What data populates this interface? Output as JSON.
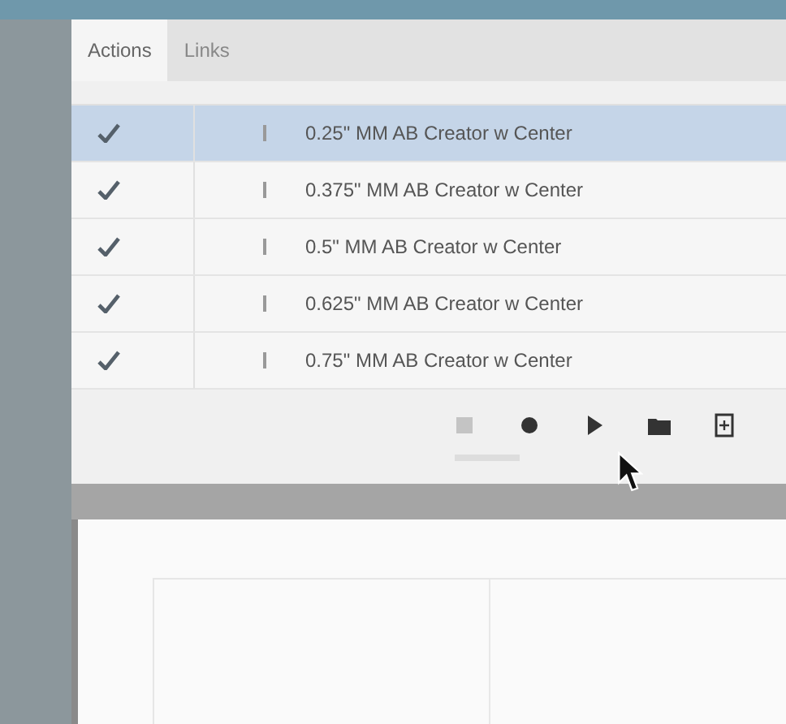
{
  "tabs": [
    {
      "label": "Actions",
      "selected": true
    },
    {
      "label": "Links",
      "selected": false
    }
  ],
  "actions": [
    {
      "name": "0.25\" MM AB Creator w Center",
      "checked": true,
      "selected": true
    },
    {
      "name": "0.375\" MM AB Creator w Center",
      "checked": true,
      "selected": false
    },
    {
      "name": "0.5\" MM AB Creator w Center",
      "checked": true,
      "selected": false
    },
    {
      "name": "0.625\" MM AB Creator w Center",
      "checked": true,
      "selected": false
    },
    {
      "name": "0.75\" MM AB Creator w Center",
      "checked": true,
      "selected": false
    }
  ],
  "toolbar": [
    {
      "kind": "stop",
      "disabled": true
    },
    {
      "kind": "record",
      "disabled": false
    },
    {
      "kind": "play",
      "disabled": false
    },
    {
      "kind": "folder",
      "disabled": false
    },
    {
      "kind": "new",
      "disabled": false
    }
  ]
}
